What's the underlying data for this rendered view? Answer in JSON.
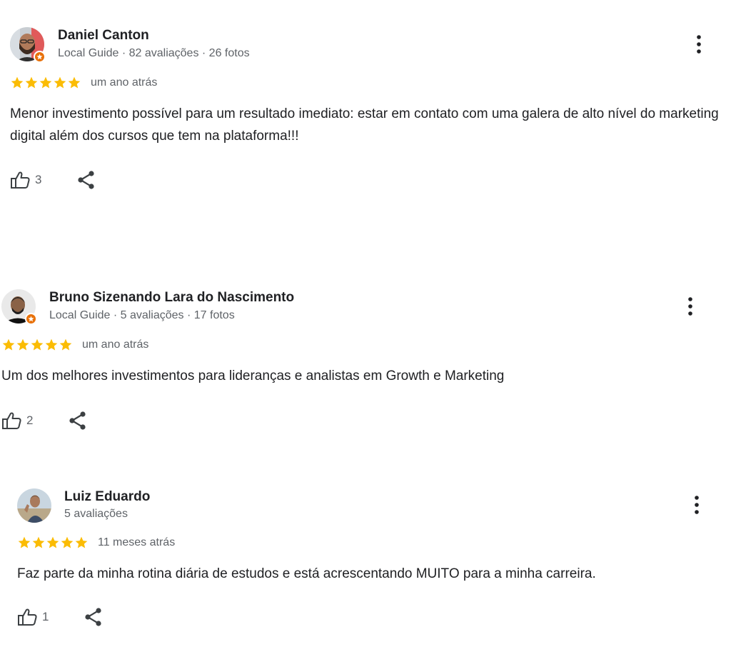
{
  "reviews": [
    {
      "name": "Daniel Canton",
      "meta": "Local Guide · 82 avaliações · 26 fotos",
      "rating": 5,
      "time": "um ano atrás",
      "text": "Menor investimento possível para um resultado imediato: estar em contato com uma galera de alto nível do marketing digital além dos cursos que tem na plataforma!!!",
      "likes": "3",
      "local_guide": true
    },
    {
      "name": "Bruno Sizenando Lara do Nascimento",
      "meta": "Local Guide · 5 avaliações · 17 fotos",
      "rating": 5,
      "time": "um ano atrás",
      "text": "Um dos melhores investimentos para lideranças e analistas em Growth e Marketing",
      "likes": "2",
      "local_guide": true
    },
    {
      "name": "Luiz Eduardo",
      "meta": "5 avaliações",
      "rating": 5,
      "time": "11 meses atrás",
      "text": "Faz parte da minha rotina diária de estudos e está acrescentando MUITO para a minha carreira.",
      "likes": "1",
      "local_guide": false
    }
  ],
  "icons": {
    "star": "star-icon",
    "more": "more-vert-icon",
    "like": "thumb-up-icon",
    "share": "share-icon",
    "guide_badge": "local-guide-badge-icon"
  },
  "colors": {
    "star": "#fbbc04",
    "guide_badge": "#e8710a",
    "text": "#202124",
    "secondary_text": "#5f6368"
  }
}
